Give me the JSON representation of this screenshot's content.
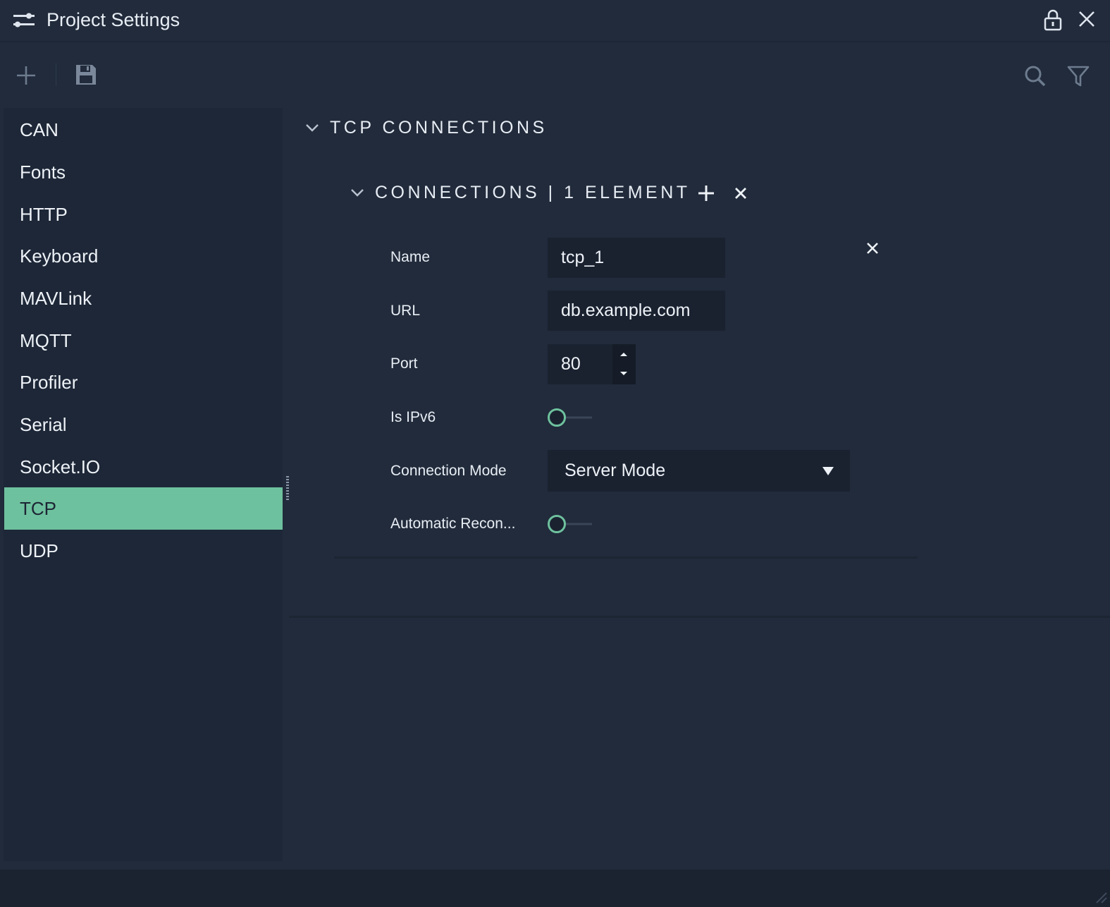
{
  "window": {
    "title": "Project Settings",
    "icon": "sliders-icon"
  },
  "toolbar": {
    "add_icon": "plus-icon",
    "save_icon": "save-icon",
    "search_icon": "search-icon",
    "filter_icon": "filter-icon"
  },
  "sidebar": {
    "items": [
      {
        "label": "CAN"
      },
      {
        "label": "Fonts"
      },
      {
        "label": "HTTP"
      },
      {
        "label": "Keyboard"
      },
      {
        "label": "MAVLink"
      },
      {
        "label": "MQTT"
      },
      {
        "label": "Profiler"
      },
      {
        "label": "Serial"
      },
      {
        "label": "Socket.IO"
      },
      {
        "label": "TCP",
        "active": true
      },
      {
        "label": "UDP"
      }
    ]
  },
  "main": {
    "section_title": "TCP CONNECTIONS",
    "connections_title": "CONNECTIONS | 1 ELEMENT",
    "fields": {
      "name": {
        "label": "Name",
        "value": "tcp_1"
      },
      "url": {
        "label": "URL",
        "value": "db.example.com"
      },
      "port": {
        "label": "Port",
        "value": "80"
      },
      "ipv6": {
        "label": "Is IPv6",
        "on": false
      },
      "mode": {
        "label": "Connection Mode",
        "value": "Server Mode"
      },
      "reconnect": {
        "label": "Automatic Recon...",
        "on": false
      }
    }
  },
  "colors": {
    "background": "#212b3b",
    "sidebar": "#1d2737",
    "accent": "#6ec19e",
    "field": "#1a2230"
  }
}
